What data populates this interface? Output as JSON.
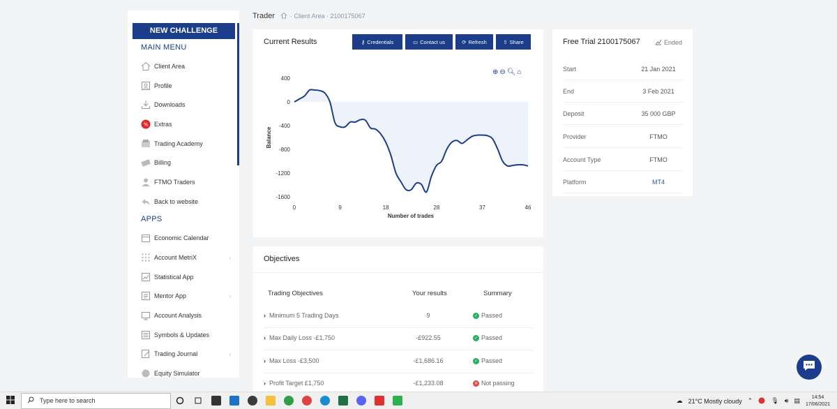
{
  "header": {
    "title": "Trader",
    "breadcrumb": "· Client Area · 2100175067"
  },
  "sidebar": {
    "new_challenge": "NEW CHALLENGE",
    "main_menu_title": "MAIN MENU",
    "main_items": [
      {
        "label": "Client Area",
        "icon": "home-icon"
      },
      {
        "label": "Profile",
        "icon": "profile-icon"
      },
      {
        "label": "Downloads",
        "icon": "download-icon"
      },
      {
        "label": "Extras",
        "icon": "percent-icon"
      },
      {
        "label": "Trading Academy",
        "icon": "academy-icon"
      },
      {
        "label": "Billing",
        "icon": "billing-icon"
      },
      {
        "label": "FTMO Traders",
        "icon": "traders-icon"
      },
      {
        "label": "Back to website",
        "icon": "back-icon"
      }
    ],
    "apps_title": "APPS",
    "app_items": [
      {
        "label": "Economic Calendar",
        "icon": "calendar-icon"
      },
      {
        "label": "Account MetriX",
        "icon": "metrix-icon",
        "has_submenu": true
      },
      {
        "label": "Statistical App",
        "icon": "stats-icon"
      },
      {
        "label": "Mentor App",
        "icon": "mentor-icon",
        "has_submenu": true
      },
      {
        "label": "Account Analysis",
        "icon": "analysis-icon"
      },
      {
        "label": "Symbols & Updates",
        "icon": "symbols-icon"
      },
      {
        "label": "Trading Journal",
        "icon": "journal-icon",
        "has_submenu": true
      },
      {
        "label": "Equity Simulator",
        "icon": "simulator-icon"
      }
    ]
  },
  "results": {
    "title": "Current Results",
    "buttons": {
      "credentials": "Credentials",
      "contact": "Contact us",
      "refresh": "Refresh",
      "share": "Share"
    }
  },
  "chart_data": {
    "type": "area",
    "xlabel": "Number of trades",
    "ylabel": "Balance",
    "xlim": [
      0,
      46
    ],
    "ylim": [
      -1600,
      400
    ],
    "x_ticks": [
      0,
      9,
      18,
      28,
      37,
      46
    ],
    "y_ticks": [
      400,
      0,
      -400,
      -800,
      -1200,
      -1600
    ],
    "grid": false,
    "series": [
      {
        "x": [
          0,
          1,
          2,
          3,
          4,
          5,
          6,
          7,
          8,
          9,
          10,
          11,
          12,
          13,
          14,
          15,
          16,
          17,
          18,
          19,
          20,
          21,
          22,
          23,
          24,
          25,
          26,
          27,
          28,
          29,
          30,
          31,
          32,
          33,
          34,
          35,
          36,
          37,
          38,
          39,
          40,
          41,
          42,
          43,
          44,
          45,
          46
        ],
        "values": [
          0,
          50,
          100,
          200,
          200,
          190,
          150,
          0,
          -350,
          -420,
          -420,
          -340,
          -340,
          -300,
          -310,
          -440,
          -460,
          -540,
          -680,
          -900,
          -1200,
          -1350,
          -1480,
          -1480,
          -1370,
          -1390,
          -1520,
          -1250,
          -1070,
          -1000,
          -800,
          -680,
          -650,
          -700,
          -640,
          -580,
          -560,
          -560,
          -570,
          -620,
          -790,
          -1000,
          -1080,
          -1070,
          -1060,
          -1060,
          -1080
        ]
      }
    ],
    "colors": {
      "line": "#1b3d8a",
      "fill": "#eef2fa"
    }
  },
  "trial": {
    "title": "Free Trial 2100175067",
    "status": "Ended",
    "rows": [
      {
        "label": "Start",
        "value": "21 Jan 2021"
      },
      {
        "label": "End",
        "value": "3 Feb 2021"
      },
      {
        "label": "Deposit",
        "value": "35 000 GBP"
      },
      {
        "label": "Provider",
        "value": "FTMO"
      },
      {
        "label": "Account Type",
        "value": "FTMO"
      },
      {
        "label": "Platform",
        "value": "MT4"
      }
    ]
  },
  "objectives": {
    "title": "Objectives",
    "headers": [
      "Trading Objectives",
      "Your results",
      "Summary"
    ],
    "rows": [
      {
        "objective": "Minimum 5 Trading Days",
        "result": "9",
        "summary": "Passed",
        "passed": true
      },
      {
        "objective": "Max Daily Loss -£1,750",
        "result": "-£922.55",
        "summary": "Passed",
        "passed": true
      },
      {
        "objective": "Max Loss -£3,500",
        "result": "-£1,686.16",
        "summary": "Passed",
        "passed": true
      },
      {
        "objective": "Profit Target £1,750",
        "result": "-£1,233.08",
        "summary": "Not passing",
        "passed": false
      }
    ]
  },
  "taskbar": {
    "search_placeholder": "Type here to search",
    "weather": "21°C  Mostly cloudy",
    "time": "14:54",
    "date": "17/06/2021"
  }
}
